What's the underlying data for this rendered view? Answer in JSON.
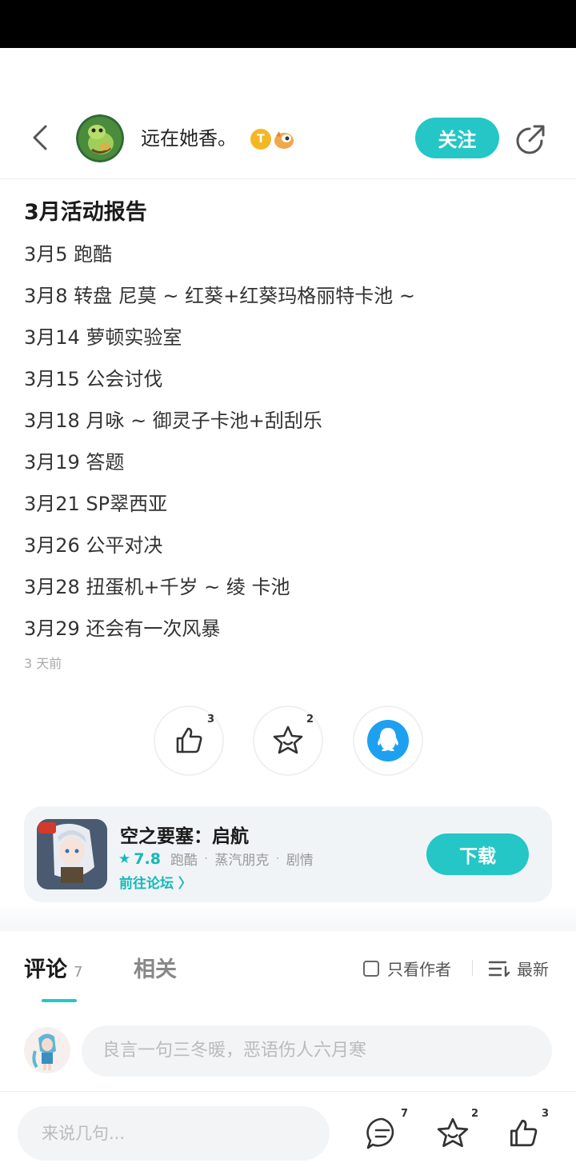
{
  "header": {
    "username": "远在她香。",
    "badge_text": "T",
    "follow_label": "关注"
  },
  "post": {
    "title": "3月活动报告",
    "lines": [
      "3月5 跑酷",
      "3月8 转盘 尼莫 ~ 红葵+红葵玛格丽特卡池 ~",
      "3月14 萝顿实验室",
      "3月15 公会讨伐",
      "3月18 月咏 ~ 御灵子卡池+刮刮乐",
      "3月19 答题",
      "3月21 SP翠西亚",
      "3月26 公平对决",
      "3月28 扭蛋机+千岁 ~ 绫 卡池",
      "3月29 还会有一次风暴"
    ],
    "time": "3 天前"
  },
  "actions": {
    "like_count": "3",
    "favorite_count": "2"
  },
  "game": {
    "name": "空之要塞：启航",
    "rating": "7.8",
    "tags": [
      "跑酷",
      "蒸汽朋克",
      "剧情"
    ],
    "forum_link": "前往论坛 〉",
    "download_label": "下载"
  },
  "tabs": {
    "comments_label": "评论",
    "comments_count": "7",
    "related_label": "相关",
    "author_only_label": "只看作者",
    "sort_label": "最新"
  },
  "comment_input": {
    "placeholder": "良言一句三冬暖，恶语伤人六月寒"
  },
  "bottom_bar": {
    "placeholder": "来说几句...",
    "comment_count": "7",
    "favorite_count": "2",
    "like_count": "3"
  },
  "colors": {
    "accent": "#24c6c6",
    "qq_blue": "#1ea0f0"
  }
}
